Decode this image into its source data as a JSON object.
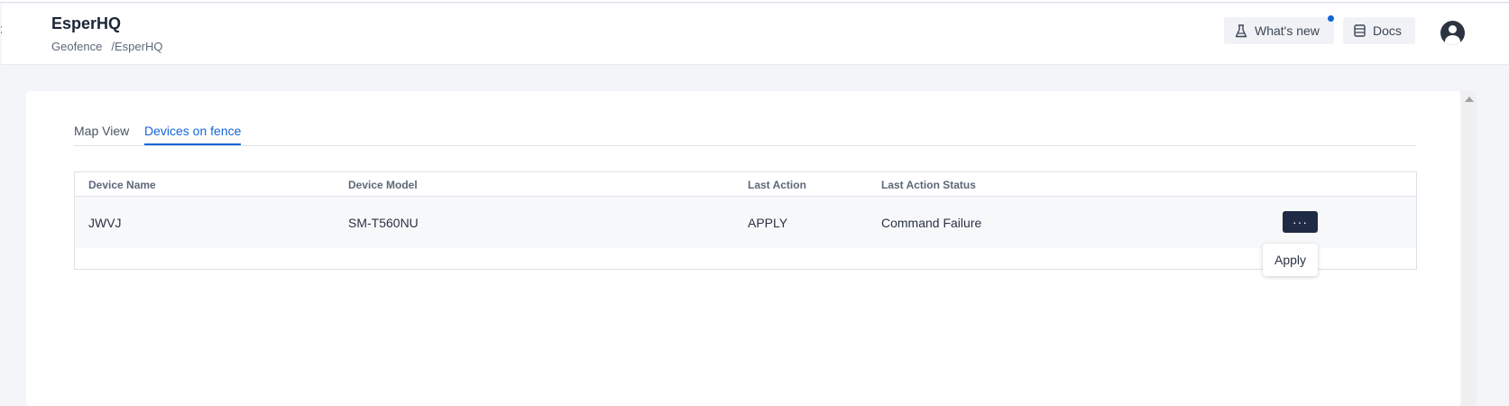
{
  "header": {
    "title": "EsperHQ",
    "breadcrumb": [
      "Geofence",
      "/EsperHQ"
    ],
    "whats_new_label": "What's new",
    "docs_label": "Docs",
    "left_edge_glyph": ":"
  },
  "icons": {
    "whats_new": "flask-icon",
    "docs": "docs-icon",
    "avatar": "user-avatar-icon"
  },
  "tabs": [
    {
      "label": "Map View",
      "active": false
    },
    {
      "label": "Devices on fence",
      "active": true
    }
  ],
  "table": {
    "columns": [
      "Device Name",
      "Device Model",
      "Last Action",
      "Last Action Status"
    ],
    "rows": [
      {
        "device_name": "JWVJ",
        "device_model": "SM-T560NU",
        "last_action": "APPLY",
        "last_action_status": "Command Failure",
        "actions_label": "···"
      }
    ]
  },
  "row_menu": {
    "items": [
      "Apply"
    ]
  },
  "colors": {
    "accent": "#1565d8",
    "action_button": "#1f2b45",
    "background": "#f3f5f9"
  }
}
